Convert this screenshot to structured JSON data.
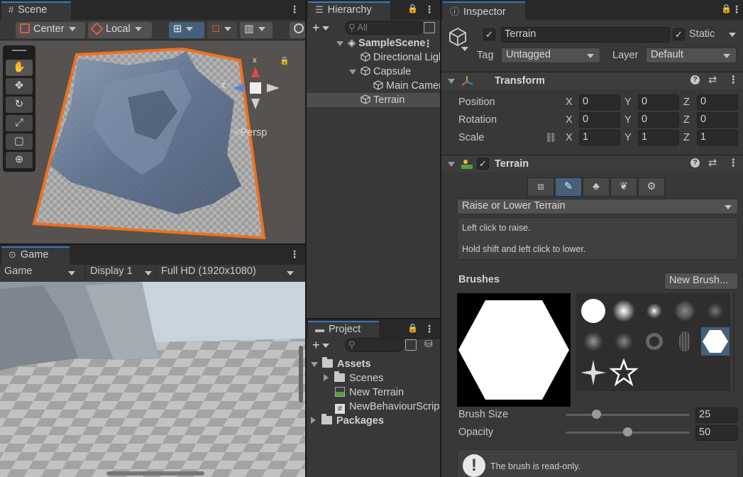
{
  "scene": {
    "tab": "Scene",
    "pivot_mode": "Center",
    "pivot_rotation": "Local",
    "gizmo_x": "x",
    "gizmo_z": "z",
    "persp": "Persp"
  },
  "game": {
    "tab": "Game",
    "mode": "Game",
    "display": "Display 1",
    "resolution": "Full HD (1920x1080)"
  },
  "hierarchy": {
    "tab": "Hierarchy",
    "search_placeholder": "All",
    "items": [
      {
        "label": "SampleScene"
      },
      {
        "label": "Directional Light"
      },
      {
        "label": "Capsule"
      },
      {
        "label": "Main Camera"
      },
      {
        "label": "Terrain"
      }
    ]
  },
  "project": {
    "tab": "Project",
    "items": [
      {
        "label": "Assets"
      },
      {
        "label": "Scenes"
      },
      {
        "label": "New Terrain"
      },
      {
        "label": "NewBehaviourScript"
      },
      {
        "label": "Packages"
      }
    ]
  },
  "inspector": {
    "tab": "Inspector",
    "object_name": "Terrain",
    "static_label": "Static",
    "tag_label": "Tag",
    "tag_value": "Untagged",
    "layer_label": "Layer",
    "layer_value": "Default",
    "transform": {
      "title": "Transform",
      "position_label": "Position",
      "rotation_label": "Rotation",
      "scale_label": "Scale",
      "axis_x": "X",
      "axis_y": "Y",
      "axis_z": "Z",
      "position": [
        "0",
        "0",
        "0"
      ],
      "rotation": [
        "0",
        "0",
        "0"
      ],
      "scale": [
        "1",
        "1",
        "1"
      ]
    },
    "terrain": {
      "title": "Terrain",
      "tool": "Raise or Lower Terrain",
      "help_line1": "Left click to raise.",
      "help_line2": "Hold shift and left click to lower.",
      "brushes_label": "Brushes",
      "new_brush": "New Brush...",
      "brush_size_label": "Brush Size",
      "brush_size_value": "25",
      "brush_size_fraction": 0.25,
      "opacity_label": "Opacity",
      "opacity_value": "50",
      "opacity_fraction": 0.5,
      "readonly_note": "The brush is read-only."
    }
  },
  "colors": {
    "accent": "#3a79bb",
    "terrain_outline": "#f07020",
    "selection": "#46607c"
  }
}
